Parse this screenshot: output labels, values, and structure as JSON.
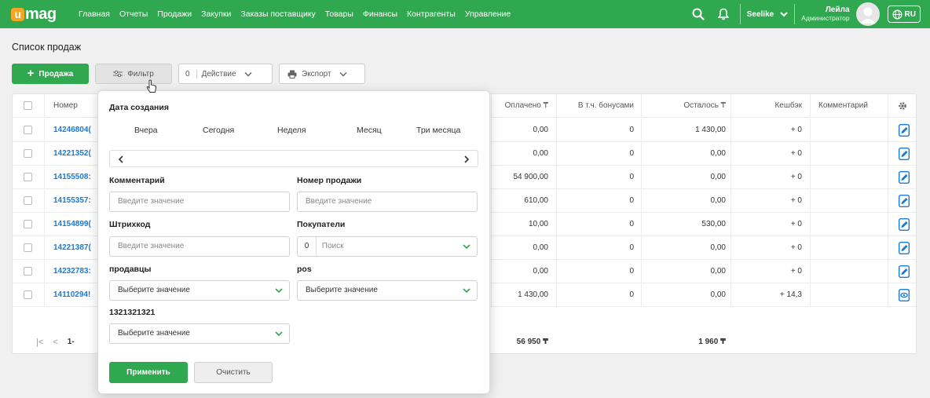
{
  "nav": {
    "logo": "mag",
    "logo_letter": "u",
    "items": [
      "Главная",
      "Отчеты",
      "Продажи",
      "Закупки",
      "Заказы поставщику",
      "Товары",
      "Финансы",
      "Контрагенты",
      "Управление"
    ],
    "store": "Seelike",
    "user_name": "Лейла",
    "user_role": "Администратор",
    "lang": "RU"
  },
  "page": {
    "title": "Список продаж",
    "add_button": "Продажа",
    "filter_button": "Фильтр",
    "action_count": "0",
    "action_button": "Действие",
    "export_button": "Экспорт"
  },
  "table": {
    "headers": [
      "Номер",
      "Оплачено ₸",
      "В т.ч. бонусами",
      "Осталось ₸",
      "Кешбэк",
      "Комментарий"
    ],
    "rows": [
      {
        "number": "14246804(",
        "paid": "0,00",
        "bonus": "0",
        "left": "1 430,00",
        "cashback": "+ 0"
      },
      {
        "number": "14221352(",
        "paid": "0,00",
        "bonus": "0",
        "left": "0,00",
        "cashback": "+ 0"
      },
      {
        "number": "14155508:",
        "paid": "54 900,00",
        "bonus": "0",
        "left": "0,00",
        "cashback": "+ 0"
      },
      {
        "number": "14155357:",
        "paid": "610,00",
        "bonus": "0",
        "left": "0,00",
        "cashback": "+ 0"
      },
      {
        "number": "14154899(",
        "paid": "10,00",
        "bonus": "0",
        "left": "530,00",
        "cashback": "+ 0"
      },
      {
        "number": "14221387(",
        "paid": "0,00",
        "bonus": "0",
        "left": "0,00",
        "cashback": "+ 0"
      },
      {
        "number": "14232783:",
        "paid": "0,00",
        "bonus": "0",
        "left": "0,00",
        "cashback": "+ 0"
      },
      {
        "number": "14110294!",
        "paid": "1 430,00",
        "bonus": "0",
        "left": "0,00",
        "cashback": "+ 14,3"
      }
    ],
    "footer": {
      "pager_prefix": "1-",
      "paid_total": "56 950 ₸",
      "left_total": "1 960 ₸"
    }
  },
  "filter": {
    "date_label": "Дата создания",
    "periods": [
      "Вчера",
      "Сегодня",
      "Неделя",
      "Месяц",
      "Три месяца"
    ],
    "comment_label": "Комментарий",
    "comment_placeholder": "Введите значение",
    "sale_number_label": "Номер продажи",
    "sale_number_placeholder": "Введите значение",
    "barcode_label": "Штрихкод",
    "barcode_placeholder": "Введите значение",
    "buyers_label": "Покупатели",
    "buyers_count": "0",
    "buyers_placeholder": "Поиск",
    "sellers_label": "продавцы",
    "sellers_value": "Выберите значение",
    "pos_label": "pos",
    "pos_value": "Выберите значение",
    "custom_label": "1321321321",
    "custom_value": "Выберите значение",
    "apply": "Применить",
    "clear": "Очистить"
  }
}
